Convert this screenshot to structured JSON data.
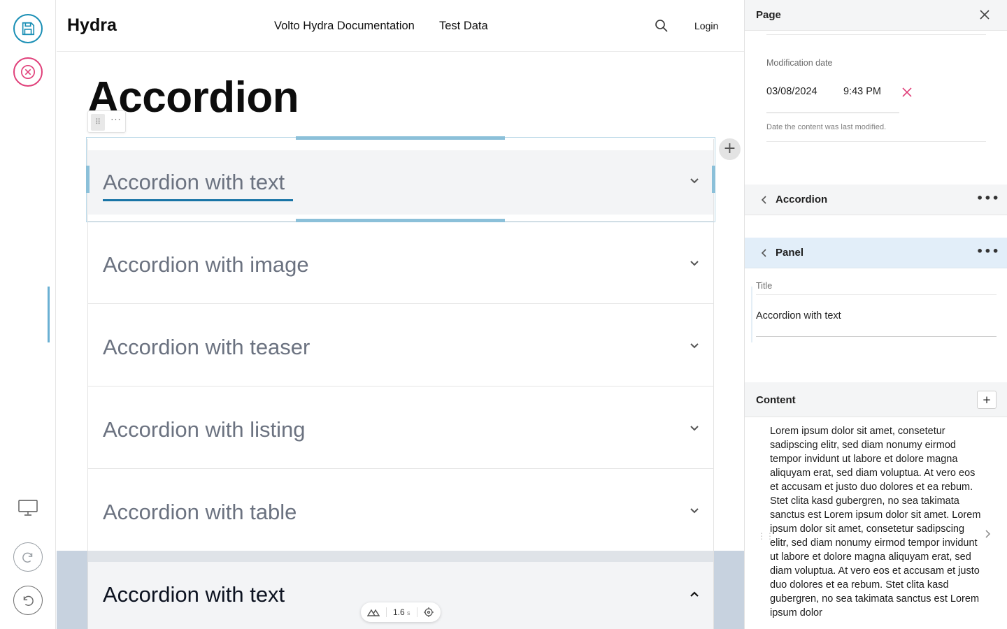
{
  "toolbar": {
    "icons": [
      "save-icon",
      "cancel-icon",
      "desktop-preview-icon",
      "redo-icon",
      "undo-icon"
    ],
    "colors": {
      "save": "#1a8fb5",
      "cancel": "#e0407a"
    }
  },
  "site": {
    "logo": "Hydra",
    "nav": [
      "Volto Hydra Documentation",
      "Test Data"
    ],
    "login": "Login"
  },
  "page": {
    "title": "Accordion"
  },
  "block_handle": {
    "drag": "⠿",
    "menu": "···"
  },
  "accordion": {
    "items": [
      {
        "title": "Accordion with text",
        "selected": true
      },
      {
        "title": "Accordion with image"
      },
      {
        "title": "Accordion with teaser"
      },
      {
        "title": "Accordion with listing"
      },
      {
        "title": "Accordion with table"
      }
    ],
    "open_item": {
      "title": "Accordion with text"
    },
    "add_label": "+"
  },
  "devtools": {
    "time_value": "1.6",
    "time_unit": "s"
  },
  "sidebar": {
    "header_title": "Page",
    "modification": {
      "label": "Modification date",
      "date": "03/08/2024",
      "time": "9:43 PM",
      "help": "Date the content was last modified."
    },
    "breadcrumbs": [
      {
        "title": "Accordion",
        "more": "•••"
      },
      {
        "title": "Panel",
        "more": "•••"
      }
    ],
    "title_field": {
      "label": "Title",
      "value": "Accordion with text"
    },
    "content": {
      "title": "Content",
      "add": "+",
      "text": "Lorem ipsum dolor sit amet, consetetur sadipscing elitr, sed diam nonumy eirmod tempor invidunt ut labore et dolore magna aliquyam erat, sed diam voluptua. At vero eos et accusam et justo duo dolores et ea rebum. Stet clita kasd gubergren, no sea takimata sanctus est Lorem ipsum dolor sit amet. Lorem ipsum dolor sit amet, consetetur sadipscing elitr, sed diam nonumy eirmod tempor invidunt ut labore et dolore magna aliquyam erat, sed diam voluptua. At vero eos et accusam et justo duo dolores et ea rebum. Stet clita kasd gubergren, no sea takimata sanctus est Lorem ipsum dolor"
    }
  }
}
